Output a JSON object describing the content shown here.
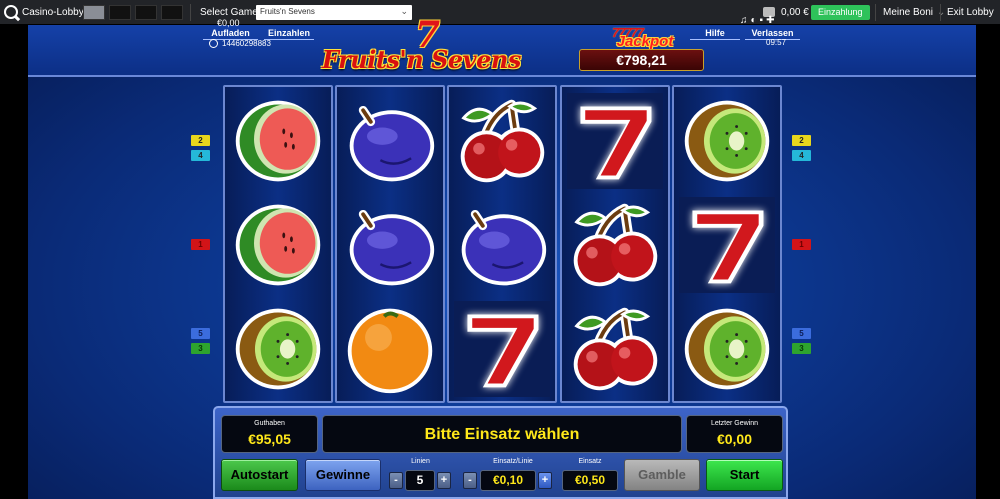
{
  "topbar": {
    "lobby": "Casino-Lobby",
    "select_label": "Select Game",
    "selected_game": "Fruits'n Sevens",
    "balance": "0,00 €",
    "deposit": "Einzahlung",
    "bonus": "Meine Boni",
    "exit": "Exit Lobby"
  },
  "header": {
    "tabs": {
      "recharge": "Aufladen",
      "deposit": "Einzahlen",
      "help": "Hilfe",
      "leave": "Verlassen"
    },
    "balance": "€0,00",
    "ticket": "14460298883",
    "time": "09:57"
  },
  "logo": {
    "title": "Fruits'n Sevens",
    "seven": "7"
  },
  "jackpot": {
    "sevens": "77777",
    "title": "Jackpot",
    "value": "€798,21"
  },
  "reels": [
    [
      "watermelon",
      "watermelon",
      "kiwi"
    ],
    [
      "plum",
      "plum",
      "orange"
    ],
    [
      "cherry",
      "plum",
      "seven"
    ],
    [
      "seven",
      "cherry",
      "cherry"
    ],
    [
      "kiwi",
      "seven",
      "kiwi"
    ]
  ],
  "lines": {
    "left": [
      "2",
      "4",
      "1",
      "5",
      "3"
    ],
    "right": [
      "2",
      "4",
      "1",
      "5",
      "3"
    ]
  },
  "panel": {
    "credit_label": "Guthaben",
    "credit": "€95,05",
    "message": "Bitte Einsatz wählen",
    "lastwin_label": "Letzter Gewinn",
    "lastwin": "€0,00",
    "autostart": "Autostart",
    "gewinne": "Gewinne",
    "lines_label": "Linien",
    "lines_value": "5",
    "bet_line_label": "Einsatz/Linie",
    "bet_line_value": "€0,10",
    "bet_label": "Einsatz",
    "bet_value": "€0,50",
    "gamble": "Gamble",
    "start": "Start",
    "minus": "-",
    "plus": "+"
  },
  "colors": {
    "panel_blue": "#3d64c8",
    "value_yellow": "#ffe81a",
    "start_green": "#2ec25a"
  }
}
